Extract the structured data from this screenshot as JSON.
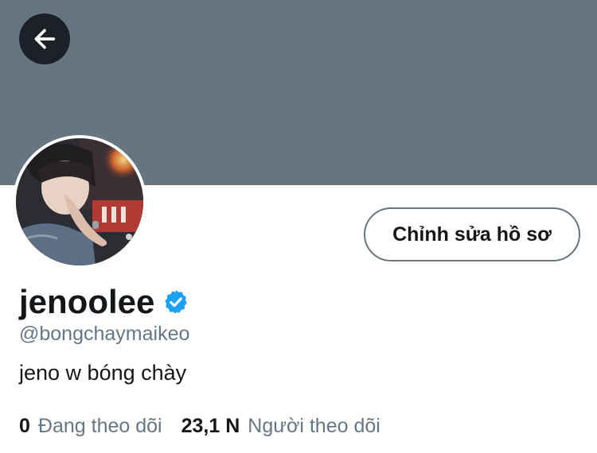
{
  "header": {
    "banner_color": "#66757f",
    "back_icon": "arrow-left-icon"
  },
  "profile": {
    "display_name": "jenoolee",
    "verified_icon": "verified-badge-icon",
    "handle": "@bongchaymaikeo",
    "bio": "jeno w bóng chày",
    "edit_button_label": "Chỉnh sửa hồ sơ"
  },
  "stats": {
    "following_count": "0",
    "following_label": "Đang theo dõi",
    "followers_count": "23,1 N",
    "followers_label": "Người theo dõi"
  },
  "colors": {
    "accent": "#1da1f2",
    "text_primary": "#14171a",
    "text_secondary": "#657786"
  }
}
